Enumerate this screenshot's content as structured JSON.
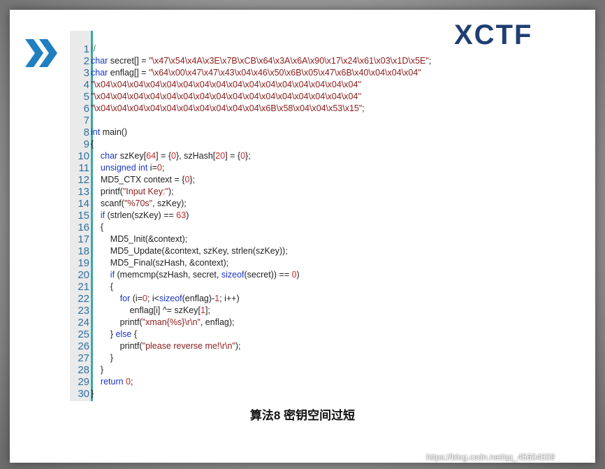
{
  "slide": {
    "logo_text": "XCTF",
    "caption": "算法8 密钥空间过短"
  },
  "code": {
    "line_numbers": [
      "1",
      "2",
      "3",
      "4",
      "5",
      "6",
      "7",
      "8",
      "9",
      "10",
      "11",
      "12",
      "13",
      "14",
      "15",
      "16",
      "17",
      "18",
      "19",
      "20",
      "21",
      "22",
      "23",
      "24",
      "25",
      "26",
      "27",
      "28",
      "29",
      "30"
    ],
    "lines": [
      [
        {
          "t": "//",
          "c": "cmt"
        }
      ],
      [
        {
          "t": "char",
          "c": "kw"
        },
        {
          "t": " secret[] = ",
          "c": ""
        },
        {
          "t": "\"\\x47\\x54\\x4A\\x3E\\x7B\\xCB\\x64\\x3A\\x6A\\x90\\x17\\x24\\x61\\x03\\x1D\\x5E\"",
          "c": "str"
        },
        {
          "t": ";",
          "c": ""
        }
      ],
      [
        {
          "t": "char",
          "c": "kw"
        },
        {
          "t": " enflag[] = ",
          "c": ""
        },
        {
          "t": "\"\\x64\\x00\\x47\\x47\\x43\\x04\\x46\\x50\\x6B\\x05\\x47\\x6B\\x40\\x04\\x04\\x04\"",
          "c": "str"
        }
      ],
      [
        {
          "t": "\"\\x04\\x04\\x04\\x04\\x04\\x04\\x04\\x04\\x04\\x04\\x04\\x04\\x04\\x04\\x04\\x04\"",
          "c": "str"
        }
      ],
      [
        {
          "t": "\"\\x04\\x04\\x04\\x04\\x04\\x04\\x04\\x04\\x04\\x04\\x04\\x04\\x04\\x04\\x04\\x04\"",
          "c": "str"
        }
      ],
      [
        {
          "t": "\"\\x04\\x04\\x04\\x04\\x04\\x04\\x04\\x04\\x04\\x04\\x6B\\x58\\x04\\x04\\x53\\x15\"",
          "c": "str"
        },
        {
          "t": ";",
          "c": ""
        }
      ],
      [],
      [
        {
          "t": "int",
          "c": "kw"
        },
        {
          "t": " main()",
          "c": ""
        }
      ],
      [
        {
          "t": "{",
          "c": ""
        }
      ],
      [
        {
          "t": "    ",
          "c": ""
        },
        {
          "t": "char",
          "c": "kw"
        },
        {
          "t": " szKey[",
          "c": ""
        },
        {
          "t": "64",
          "c": "num"
        },
        {
          "t": "] = {",
          "c": ""
        },
        {
          "t": "0",
          "c": "num"
        },
        {
          "t": "}, szHash[",
          "c": ""
        },
        {
          "t": "20",
          "c": "num"
        },
        {
          "t": "] = {",
          "c": ""
        },
        {
          "t": "0",
          "c": "num"
        },
        {
          "t": "};",
          "c": ""
        }
      ],
      [
        {
          "t": "    ",
          "c": ""
        },
        {
          "t": "unsigned int",
          "c": "kw"
        },
        {
          "t": " i=",
          "c": ""
        },
        {
          "t": "0",
          "c": "num"
        },
        {
          "t": ";",
          "c": ""
        }
      ],
      [
        {
          "t": "    MD5_CTX context = {",
          "c": ""
        },
        {
          "t": "0",
          "c": "num"
        },
        {
          "t": "};",
          "c": ""
        }
      ],
      [
        {
          "t": "    printf(",
          "c": ""
        },
        {
          "t": "\"Input Key:\"",
          "c": "str"
        },
        {
          "t": ");",
          "c": ""
        }
      ],
      [
        {
          "t": "    scanf(",
          "c": ""
        },
        {
          "t": "\"%70s\"",
          "c": "str"
        },
        {
          "t": ", szKey);",
          "c": ""
        }
      ],
      [
        {
          "t": "    ",
          "c": ""
        },
        {
          "t": "if",
          "c": "kw"
        },
        {
          "t": " (strlen(szKey) == ",
          "c": ""
        },
        {
          "t": "63",
          "c": "num"
        },
        {
          "t": ")",
          "c": ""
        }
      ],
      [
        {
          "t": "    {",
          "c": ""
        }
      ],
      [
        {
          "t": "        MD5_Init(&context);",
          "c": ""
        }
      ],
      [
        {
          "t": "        MD5_Update(&context, szKey, strlen(szKey));",
          "c": ""
        }
      ],
      [
        {
          "t": "        MD5_Final(szHash, &context);",
          "c": ""
        }
      ],
      [
        {
          "t": "        ",
          "c": ""
        },
        {
          "t": "if",
          "c": "kw"
        },
        {
          "t": " (memcmp(szHash, secret, ",
          "c": ""
        },
        {
          "t": "sizeof",
          "c": "kw"
        },
        {
          "t": "(secret)) == ",
          "c": ""
        },
        {
          "t": "0",
          "c": "num"
        },
        {
          "t": ")",
          "c": ""
        }
      ],
      [
        {
          "t": "        {",
          "c": ""
        }
      ],
      [
        {
          "t": "            ",
          "c": ""
        },
        {
          "t": "for",
          "c": "kw"
        },
        {
          "t": " (i=",
          "c": ""
        },
        {
          "t": "0",
          "c": "num"
        },
        {
          "t": "; i<",
          "c": ""
        },
        {
          "t": "sizeof",
          "c": "kw"
        },
        {
          "t": "(enflag)-",
          "c": ""
        },
        {
          "t": "1",
          "c": "num"
        },
        {
          "t": "; i++)",
          "c": ""
        }
      ],
      [
        {
          "t": "                enflag[i] ^= szKey[",
          "c": ""
        },
        {
          "t": "1",
          "c": "num"
        },
        {
          "t": "];",
          "c": ""
        }
      ],
      [
        {
          "t": "            printf(",
          "c": ""
        },
        {
          "t": "\"xman{%s}\\r\\n\"",
          "c": "str"
        },
        {
          "t": ", enflag);",
          "c": ""
        }
      ],
      [
        {
          "t": "        } ",
          "c": ""
        },
        {
          "t": "else",
          "c": "kw"
        },
        {
          "t": " {",
          "c": ""
        }
      ],
      [
        {
          "t": "            printf(",
          "c": ""
        },
        {
          "t": "\"please reverse me!\\r\\n\"",
          "c": "str"
        },
        {
          "t": ");",
          "c": ""
        }
      ],
      [
        {
          "t": "        }",
          "c": ""
        }
      ],
      [
        {
          "t": "    }",
          "c": ""
        }
      ],
      [
        {
          "t": "    ",
          "c": ""
        },
        {
          "t": "return",
          "c": "kw"
        },
        {
          "t": " ",
          "c": ""
        },
        {
          "t": "0",
          "c": "num"
        },
        {
          "t": ";",
          "c": ""
        }
      ],
      [
        {
          "t": "}",
          "c": ""
        }
      ]
    ]
  },
  "watermark": "https://blog.csdn.net/qq_45604009",
  "colors": {
    "keyword": "#1a34c8",
    "string": "#8b1b1b",
    "number": "#c22b2b",
    "comment": "#2e8b57",
    "gutter_bar": "#3aa8a8",
    "chevron": "#1f7fc0"
  }
}
